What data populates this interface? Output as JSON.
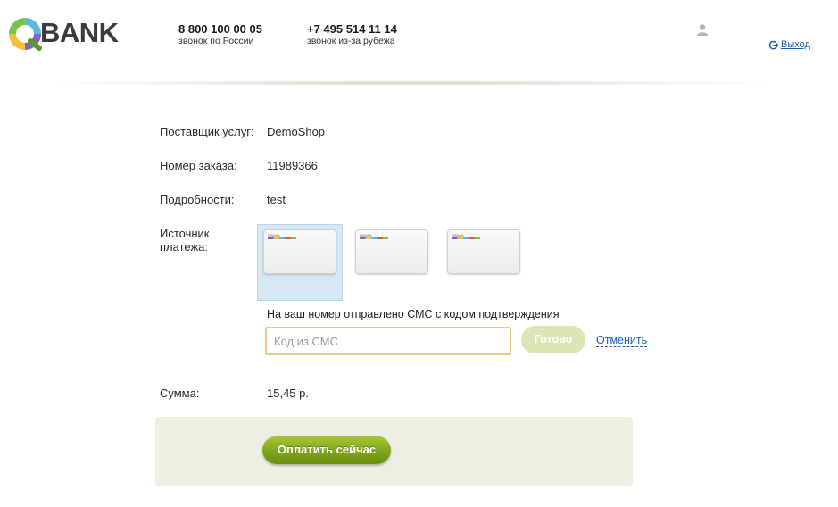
{
  "header": {
    "logo_text": "BANK",
    "phones": [
      {
        "number": "8 800 100 00 05",
        "note": "звонок по России"
      },
      {
        "number": "+7 495 514 11 14",
        "note": "звонок из-за рубежа"
      }
    ],
    "user_icon": "user-icon",
    "logout_label": "Выход",
    "logout_icon": "logout-icon"
  },
  "order": {
    "provider_label": "Поставщик услуг:",
    "provider_value": "DemoShop",
    "order_number_label": "Номер заказа:",
    "order_number_value": "11989366",
    "details_label": "Подробности:",
    "details_value": "test",
    "source_label": "Источник платежа:",
    "cards": [
      {
        "name": "QBANK",
        "selected": true
      },
      {
        "name": "QBANK",
        "selected": false
      },
      {
        "name": "QBANK",
        "selected": false
      }
    ]
  },
  "sms": {
    "note": "На ваш номер отправлено СМС с кодом подтверждения",
    "placeholder": "Код из СМС",
    "value": "",
    "done_label": "Готово",
    "cancel_label": "Отменить"
  },
  "sum": {
    "label": "Сумма:",
    "value": "15,45 р."
  },
  "pay": {
    "button_label": "Оплатить сейчас"
  },
  "colors": {
    "accent_green": "#7fa51c",
    "link_blue": "#1f5fb0",
    "selected_card_bg": "#d5e8f3"
  }
}
